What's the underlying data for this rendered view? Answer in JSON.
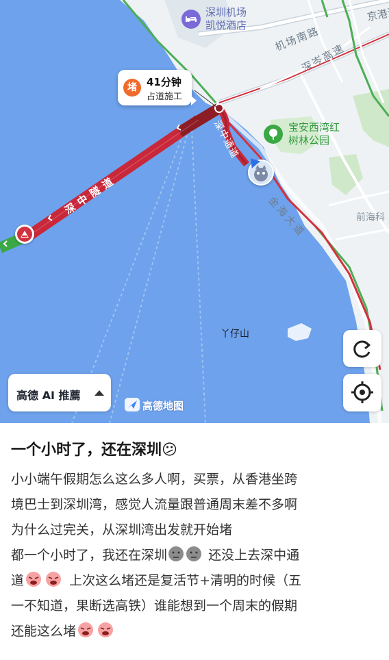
{
  "map": {
    "pois": {
      "airport_hotel": "深圳机场\n凯悦酒店",
      "park": "宝安西湾红\n树林公园",
      "island": "丫仔山"
    },
    "roads": {
      "jingyue": "京港澳",
      "airport_south": "机场南路",
      "shencen": "深岑高速",
      "qianhai": "前海科",
      "jinhai": "金海大道",
      "tunnel_approach": "深中通道"
    },
    "tunnel_label": "深中隧道",
    "traffic_bubble": {
      "badge": "堵",
      "time": "41分钟",
      "reason": "占道施工"
    },
    "ai_button_label": "高德 AI 推薦",
    "watermark": "高德地图",
    "icons": [
      "hotel-icon",
      "park-icon",
      "refresh-icon",
      "locate-icon",
      "construction-icon",
      "user-avatar"
    ],
    "colors": {
      "water": "#6ea2ec",
      "land": "#eef2f4",
      "jam_red": "#c8283a",
      "dark_jam": "#8e1c25",
      "clear_green": "#3aa845",
      "badge_orange": "#f06a2b"
    }
  },
  "post": {
    "title": "一个小时了，还在深圳😕",
    "lines": [
      "小小端午假期怎么这么多人啊，买票，从香港坐跨",
      "境巴士到深圳湾，感觉人流量跟普通周末差不多啊",
      "为什么过完关，从深圳湾出发就开始堵",
      "都一个小时了，我还在深圳",
      "还没上去深中通",
      "道",
      "上次这么堵还是复活节+清明的时候（五",
      "一不知道，果断选高铁）谁能想到一个周末的假期",
      "还能这么堵"
    ]
  }
}
